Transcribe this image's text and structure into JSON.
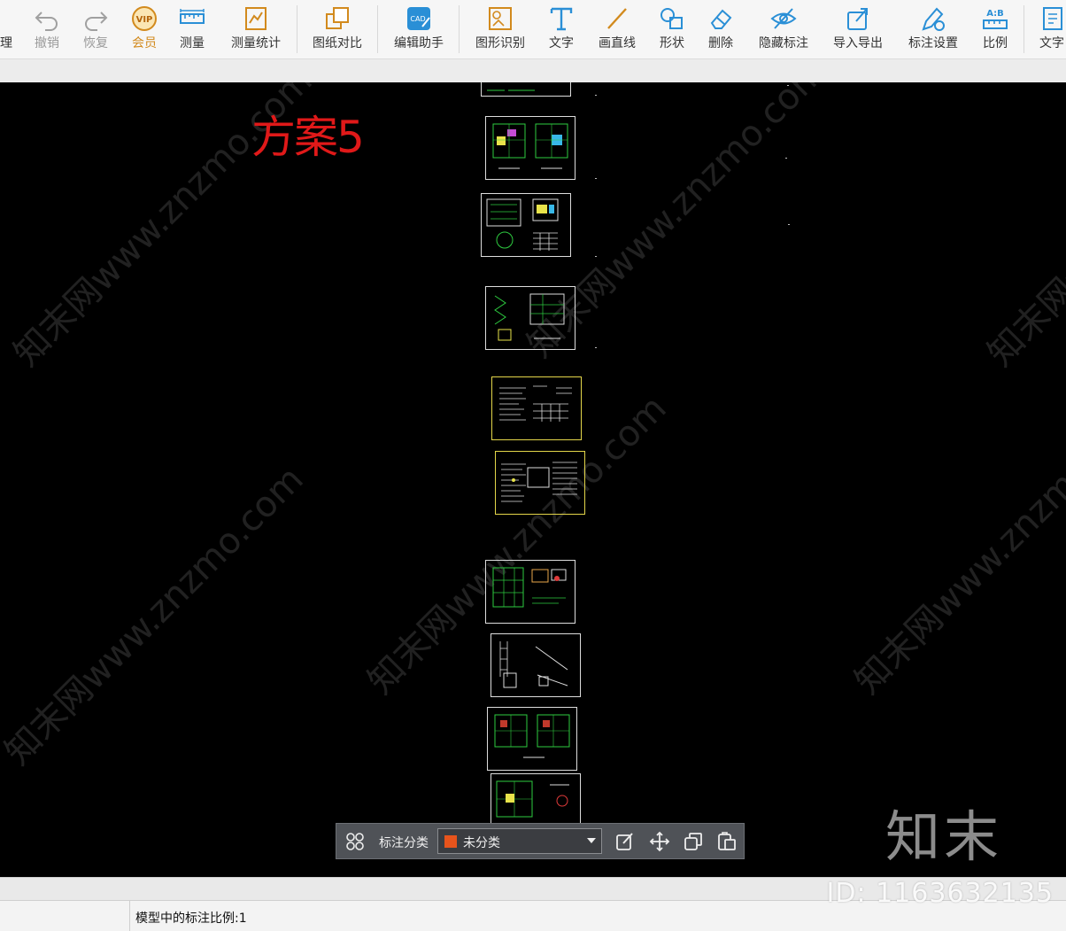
{
  "toolbar": {
    "partial_left": "理",
    "items": [
      {
        "label": "撤销",
        "icon": "undo-icon"
      },
      {
        "label": "恢复",
        "icon": "redo-icon"
      },
      {
        "label": "会员",
        "icon": "vip-icon",
        "badge": "VIP"
      },
      {
        "label": "测量",
        "icon": "measure-icon"
      },
      {
        "label": "测量统计",
        "icon": "measure-stats-icon"
      },
      {
        "label": "图纸对比",
        "icon": "compare-icon"
      },
      {
        "label": "编辑助手",
        "icon": "cad-edit-icon",
        "badge": "CAD"
      },
      {
        "label": "图形识别",
        "icon": "shape-recognize-icon"
      },
      {
        "label": "文字",
        "icon": "text-icon"
      },
      {
        "label": "画直线",
        "icon": "line-icon"
      },
      {
        "label": "形状",
        "icon": "shape-icon"
      },
      {
        "label": "删除",
        "icon": "eraser-icon"
      },
      {
        "label": "隐藏标注",
        "icon": "hide-eye-icon"
      },
      {
        "label": "导入导出",
        "icon": "import-export-icon"
      },
      {
        "label": "标注设置",
        "icon": "annotation-settings-icon"
      },
      {
        "label": "比例",
        "icon": "scale-icon",
        "badge": "A:B"
      },
      {
        "label": "文字",
        "icon": "text-search-icon"
      }
    ]
  },
  "canvas": {
    "title": "方案5",
    "watermark": "知末网www.znzmo.com",
    "brand": "知末",
    "id_text": "ID: 1163632135"
  },
  "annotation_bar": {
    "label": "标注分类",
    "category": "未分类",
    "category_color": "#e8541c"
  },
  "status": {
    "scale_text": "模型中的标注比例:1"
  },
  "colors": {
    "accent": "#2a8fd6",
    "vip": "#d28a1d",
    "drawing_green": "#2ecc40",
    "title_red": "#e01919"
  }
}
